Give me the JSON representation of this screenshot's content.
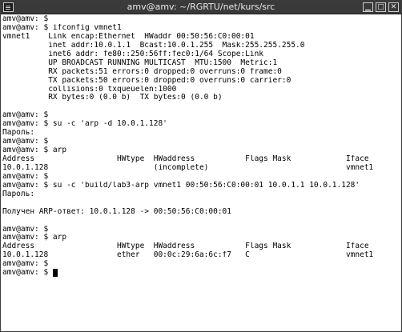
{
  "window": {
    "title": "amv@amv: ~/RGRTU/net/kurs/src",
    "buttons": {
      "minimize": "▁",
      "maximize": "□",
      "close": "✕"
    }
  },
  "terminal": {
    "lines": [
      "amv@amv: $",
      "amv@amv: $ ifconfig vmnet1",
      "vmnet1    Link encap:Ethernet  HWaddr 00:50:56:C0:00:01",
      "          inet addr:10.0.1.1  Bcast:10.0.1.255  Mask:255.255.255.0",
      "          inet6 addr: fe80::250:56ff:fec0:1/64 Scope:Link",
      "          UP BROADCAST RUNNING MULTICAST  MTU:1500  Metric:1",
      "          RX packets:51 errors:0 dropped:0 overruns:0 frame:0",
      "          TX packets:50 errors:0 dropped:0 overruns:0 carrier:0",
      "          collisions:0 txqueuelen:1000",
      "          RX bytes:0 (0.0 b)  TX bytes:0 (0.0 b)",
      "",
      "amv@amv: $",
      "amv@amv: $ su -c 'arp -d 10.0.1.128'",
      "Пароль:",
      "amv@amv: $",
      "amv@amv: $ arp",
      "Address                  HWtype  HWaddress           Flags Mask            Iface",
      "10.0.1.128                       (incomplete)                              vmnet1",
      "amv@amv: $",
      "amv@amv: $ su -c 'build/lab3-arp vmnet1 00:50:56:C0:00:01 10.0.1.1 10.0.1.128'",
      "Пароль:",
      "",
      "Получен ARP-ответ: 10.0.1.128 -> 00:50:56:C0:00:01",
      "",
      "amv@amv: $",
      "amv@amv: $ arp",
      "Address                  HWtype  HWaddress           Flags Mask            Iface",
      "10.0.1.128               ether   00:0c:29:6a:6c:f7   C                     vmnet1",
      "amv@amv: $",
      "amv@amv: $ "
    ]
  }
}
